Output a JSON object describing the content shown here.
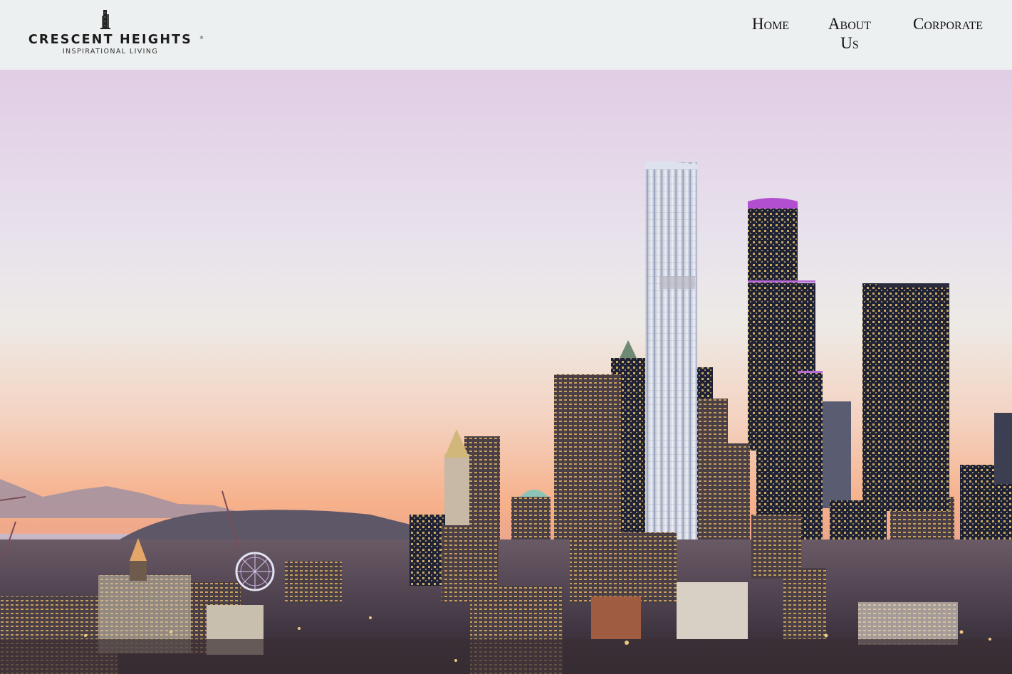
{
  "brand": {
    "name": "CRESCENT HEIGHTS",
    "trademark": "®",
    "tagline": "INSPIRATIONAL LIVING"
  },
  "nav": {
    "home": "Home",
    "about_line1": "About",
    "about_line2": "Us",
    "corporate": "Corporate"
  },
  "colors": {
    "header_bg": "#edf0f0",
    "nav_text": "#111111",
    "sky_top": "#e2cfe6",
    "sky_mid": "#ebe5ec",
    "sky_horizon": "#f4b08a"
  },
  "hero": {
    "image": "city-skyline-at-dusk"
  }
}
